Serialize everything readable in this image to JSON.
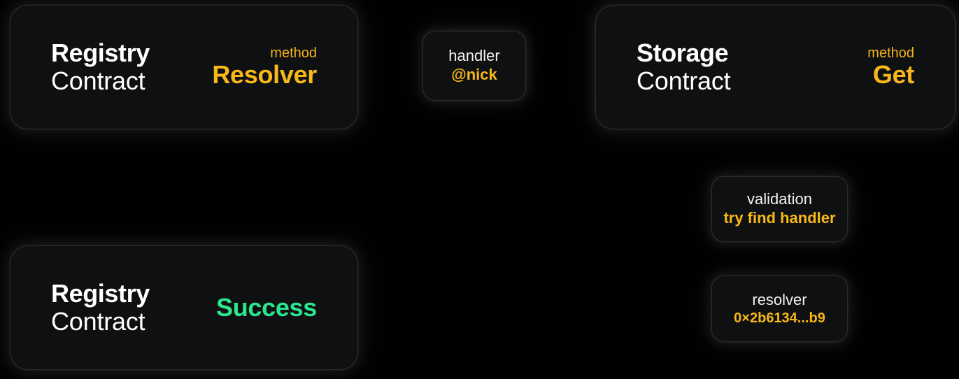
{
  "theme": {
    "background": "#000000",
    "card_background": "#0f1011",
    "card_border": "#2a2b2d",
    "text_primary": "#ffffff",
    "accent_amber": "#f8b819",
    "accent_green": "#2ce68e"
  },
  "nodes": {
    "registry_request": {
      "title_strong": "Registry",
      "title_light": "Contract",
      "meta_label": "method",
      "meta_value": "Resolver"
    },
    "handler": {
      "label": "handler",
      "value": "@nick"
    },
    "storage": {
      "title_strong": "Storage",
      "title_light": "Contract",
      "meta_label": "method",
      "meta_value": "Get"
    },
    "validation": {
      "label": "validation",
      "value": "try find handler"
    },
    "resolver": {
      "label": "resolver",
      "value": "0×2b6134...b9"
    },
    "registry_response": {
      "title_strong": "Registry",
      "title_light": "Contract",
      "status_value": "Success"
    }
  }
}
